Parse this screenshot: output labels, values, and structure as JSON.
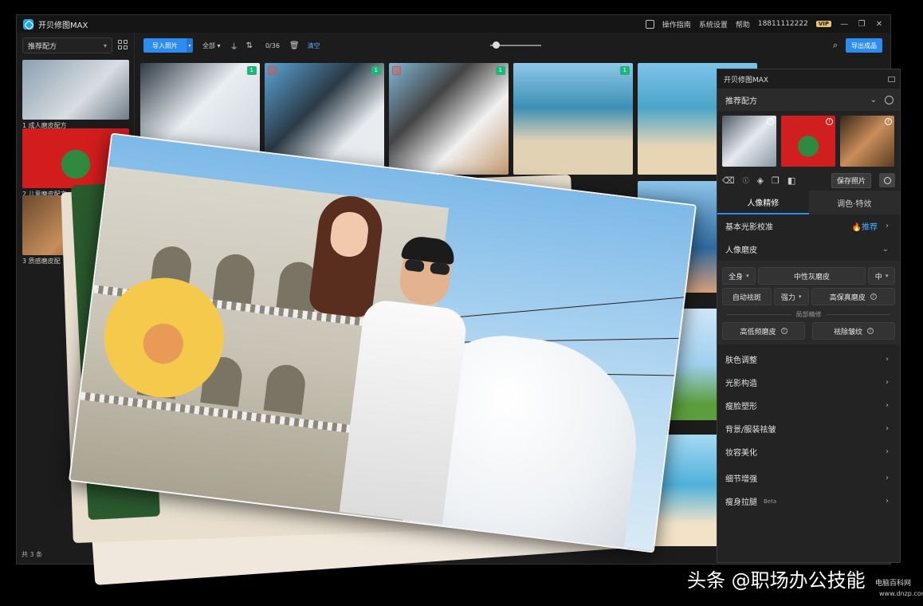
{
  "app": {
    "title": "开贝修图MAX",
    "menu": [
      "操作指南",
      "系统设置",
      "帮助"
    ],
    "phone": "18811112222",
    "vip": "VIP"
  },
  "sidebar": {
    "preset_select": "推荐配方",
    "presets": [
      {
        "label": "1 成人磨皮配方"
      },
      {
        "label": "2 儿童磨皮配方"
      },
      {
        "label": "3 质感磨皮配"
      }
    ],
    "footer": "共 3 条"
  },
  "toolbar": {
    "import": "导入照片",
    "filter": "全部",
    "count": "0/36",
    "clear": "清空",
    "export": "导出成品"
  },
  "gallery": {
    "badges": [
      "1",
      "1",
      "1",
      "1"
    ]
  },
  "panel": {
    "title": "开贝修图MAX",
    "preset": "推荐配方",
    "save": "保存照片",
    "tabs": [
      "人像精修",
      "调色·特效"
    ],
    "basic_light": "基本光影校准",
    "recommend": "推荐",
    "portrait_smooth": "人像磨皮",
    "row1": {
      "scope": "全身",
      "mode": "中性灰磨皮",
      "level": "中"
    },
    "row2": {
      "spot": "自动祛斑",
      "strength": "强力",
      "hifi": "高保真磨皮"
    },
    "local_label": "局部精修",
    "row3": {
      "freq": "高低频磨皮",
      "wrinkle": "祛除皱纹"
    },
    "sections": [
      "肤色调整",
      "光影构造",
      "瘦脸塑形",
      "背景/服装祛皱",
      "妆容美化",
      "细节增强",
      "瘦身拉腿"
    ],
    "beta": "Beta"
  },
  "watermark": {
    "text": "头条 @职场办公技能",
    "site": "电脑百科网",
    "url": "www.dnzp.com"
  }
}
